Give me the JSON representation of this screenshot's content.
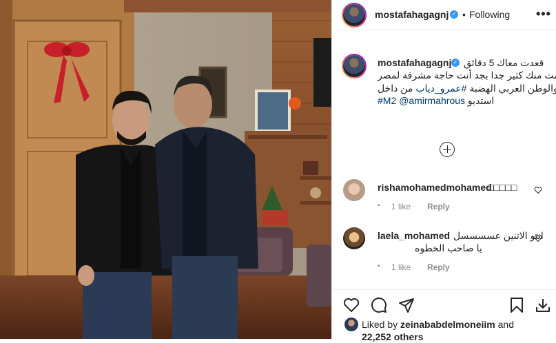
{
  "header": {
    "username": "mostafahagagnj",
    "separator": "•",
    "following_label": "Following",
    "more_label": "•••"
  },
  "caption": {
    "username": "mostafahagagnj",
    "line1": "قعدت معاك 5 دقائق",
    "line2": "اتعلمت منك كثير جدا بجد أنت حاجة مشرفة لمصر",
    "line3_text": "والوطن العربي الهضبة",
    "line3_tag": "#عمرو_دياب",
    "line3_end": "من داخل",
    "line4_text": "استديو",
    "line4_tags": "#M2 @amirmahrous"
  },
  "comments": [
    {
      "username": "rishamohamedmohamed",
      "text": "",
      "likes": "1 like",
      "reply": "Reply"
    },
    {
      "username": "laela_mohamed",
      "text": "انتو الاتنين عسسسسل",
      "text2": "يا صاحب الخطوه",
      "likes": "1 like",
      "reply": "Reply"
    }
  ],
  "likes_line": {
    "prefix": "Liked by",
    "user": "zeinababdelmoneiim",
    "and": "and",
    "count": "22,252 others"
  },
  "icons": [
    "heart-icon",
    "comment-icon",
    "share-icon",
    "bookmark-icon",
    "download-icon",
    "verified-icon",
    "load-more-icon"
  ],
  "colors": {
    "link": "#00376b",
    "meta": "#8e8e8e",
    "verified": "#3897f0",
    "text": "#262626"
  }
}
